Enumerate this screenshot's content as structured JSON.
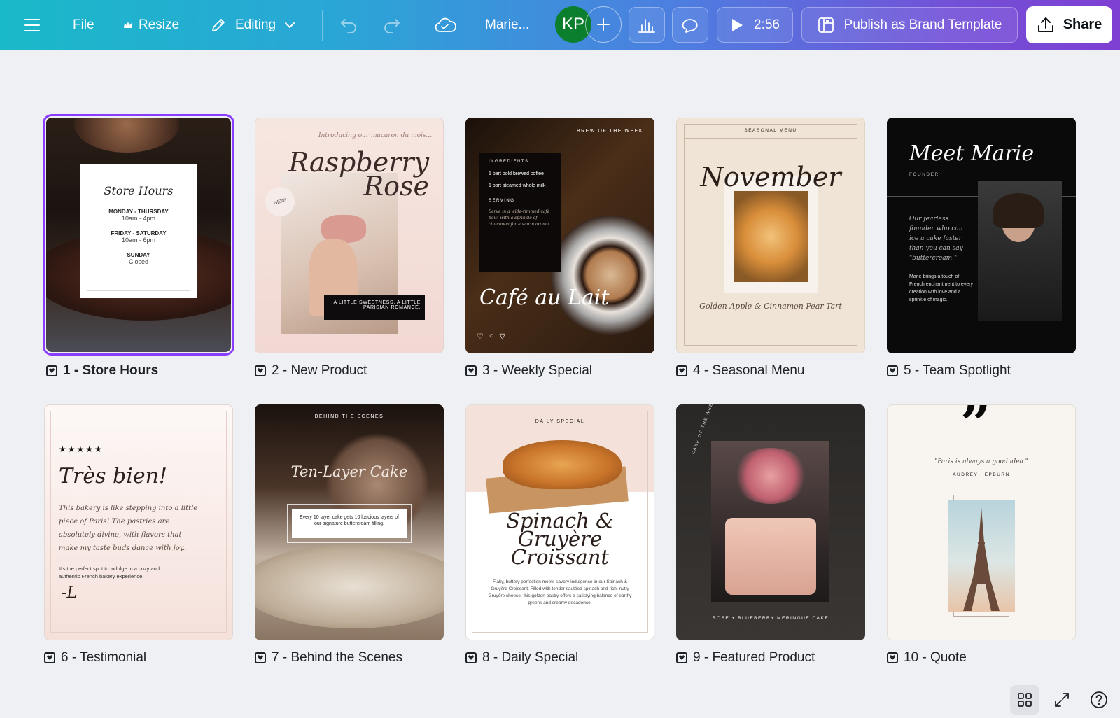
{
  "toolbar": {
    "file_label": "File",
    "resize_label": "Resize",
    "editing_label": "Editing",
    "design_name": "Marie...",
    "avatar_initials": "KP",
    "timer_label": "2:56",
    "publish_label": "Publish as Brand Template",
    "share_label": "Share"
  },
  "pages": [
    {
      "label": "1 - Store Hours"
    },
    {
      "label": "2 - New Product"
    },
    {
      "label": "3 - Weekly Special"
    },
    {
      "label": "4 - Seasonal Menu"
    },
    {
      "label": "5 - Team Spotlight"
    },
    {
      "label": "6 - Testimonial"
    },
    {
      "label": "7 - Behind the Scenes"
    },
    {
      "label": "8 - Daily Special"
    },
    {
      "label": "9 - Featured Product"
    },
    {
      "label": "10 - Quote"
    }
  ],
  "p1": {
    "title": "Store Hours",
    "l1": "MONDAY - THURSDAY",
    "l1v": "10am - 4pm",
    "l2": "FRIDAY - SATURDAY",
    "l2v": "10am - 6pm",
    "l3": "SUNDAY",
    "l3v": "Closed"
  },
  "p2": {
    "intro": "Introducing our macaron du mois...",
    "title1": "Raspberry",
    "title2": "Rose",
    "badge": "NEW!",
    "tag": "A LITTLE SWEETNESS, A LITTLE PARISIAN ROMANCE."
  },
  "p3": {
    "brew": "BREW OF THE WEEK",
    "ing_h": "INGREDIENTS",
    "ing1": "1 part bold brewed coffee",
    "ing2": "1 part steamed whole milk",
    "serv_h": "SERVING",
    "serv": "Serve in a wide-rimmed café bowl with a sprinkle of cinnamon for a warm aroma",
    "title": "Café au Lait"
  },
  "p4": {
    "head": "SEASONAL MENU",
    "title": "November",
    "caption": "Golden Apple & Cinnamon Pear Tart"
  },
  "p5": {
    "title": "Meet Marie",
    "role": "FOUNDER",
    "quote": "Our fearless founder who can ice a cake faster than you can say \"buttercream.\"",
    "body": "Marie brings a touch of French enchantment to every creation with love and a sprinkle of magic."
  },
  "p6": {
    "stars": "★★★★★",
    "title": "Très bien!",
    "quote": "This bakery is like stepping into a little piece of Paris! The pastries are absolutely divine, with flavors that make my taste buds dance with joy.",
    "body": "It's the perfect spot to indulge in a cozy and authentic French bakery experience.",
    "sign": "-L"
  },
  "p7": {
    "head": "BEHIND THE SCENES",
    "title": "Ten-Layer Cake",
    "body": "Every 10 layer cake gets 10 luscious layers of our signature buttercream filling."
  },
  "p8": {
    "head": "DAILY SPECIAL",
    "title1": "Spinach &",
    "title2": "Gruyère",
    "title3": "Croissant",
    "body": "Flaky, buttery perfection meets savory indulgence in our Spinach & Gruyère Croissant. Filled with tender sautéed spinach and rich, nutty Gruyère cheese, this golden pastry offers a satisfying balance of earthy greens and creamy decadence."
  },
  "p9": {
    "ring": "CAKE OF THE WEEK",
    "caption": "ROSE + BLUEBERRY MERINGUE CAKE"
  },
  "p10": {
    "quote": "\"Paris is always a good idea.\"",
    "author": "AUDREY HEPBURN"
  },
  "colors": {
    "accent": "#8b3dff",
    "avatar": "#0b7f2e",
    "canvas": "#eff0f4"
  }
}
